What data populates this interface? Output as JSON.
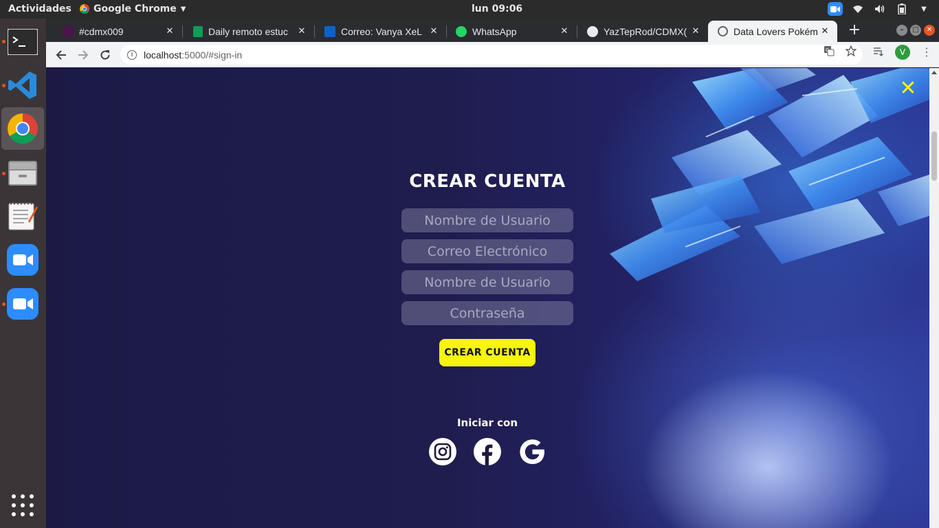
{
  "topbar": {
    "activities": "Actividades",
    "app_name": "Google Chrome",
    "clock": "lun 09:06"
  },
  "tabs": [
    {
      "title": "#cdmx009"
    },
    {
      "title": "Daily remoto estuc"
    },
    {
      "title": "Correo: Vanya XeL"
    },
    {
      "title": "WhatsApp"
    },
    {
      "title": "YazTepRod/CDMX("
    },
    {
      "title": "Data Lovers Pokém",
      "active": true
    }
  ],
  "toolbar": {
    "url_host": "localhost",
    "url_path": ":5000/#sign-in",
    "profile_initial": "V"
  },
  "page": {
    "title": "CREAR CUENTA",
    "fields": [
      {
        "placeholder": "Nombre de Usuario"
      },
      {
        "placeholder": "Correo Electrónico"
      },
      {
        "placeholder": "Nombre de Usuario"
      },
      {
        "placeholder": "Contraseña"
      }
    ],
    "submit_label": "CREAR CUENTA",
    "login_with": "Iniciar con",
    "close_symbol": "✕",
    "accent_color": "#f6f50b"
  },
  "dock": [
    "terminal-icon",
    "vscode-icon",
    "chrome-icon",
    "files-icon",
    "text-editor-icon",
    "zoom-icon",
    "zoom-icon"
  ]
}
